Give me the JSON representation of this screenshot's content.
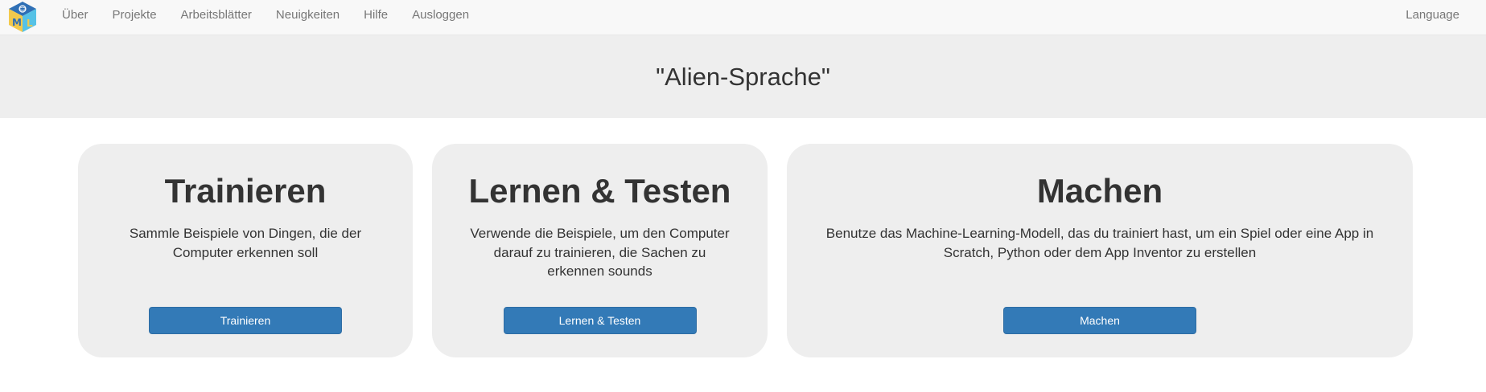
{
  "nav": {
    "items": [
      {
        "label": "Über"
      },
      {
        "label": "Projekte"
      },
      {
        "label": "Arbeitsblätter"
      },
      {
        "label": "Neuigkeiten"
      },
      {
        "label": "Hilfe"
      },
      {
        "label": "Ausloggen"
      }
    ],
    "language_label": "Language"
  },
  "hero": {
    "title": "\"Alien-Sprache\""
  },
  "cards": [
    {
      "title": "Trainieren",
      "description": "Sammle Beispiele von Dingen, die der Computer erkennen soll",
      "button_label": "Trainieren"
    },
    {
      "title": "Lernen & Testen",
      "description": "Verwende die Beispiele, um den Computer darauf zu trainieren, die Sachen zu erkennen sounds",
      "button_label": "Lernen & Testen"
    },
    {
      "title": "Machen",
      "description": "Benutze das Machine-Learning-Modell, das du trainiert hast, um ein Spiel oder eine App in Scratch, Python oder dem App Inventor zu erstellen",
      "button_label": "Machen"
    }
  ],
  "colors": {
    "button_primary": "#337ab7",
    "card_background": "#eeeeee",
    "navbar_background": "#f8f8f8",
    "logo_blue": "#2f6fb5",
    "logo_yellow": "#f2c94c",
    "logo_cyan": "#56c2e6"
  },
  "icons": {
    "logo": "ml-cube-logo-icon"
  }
}
